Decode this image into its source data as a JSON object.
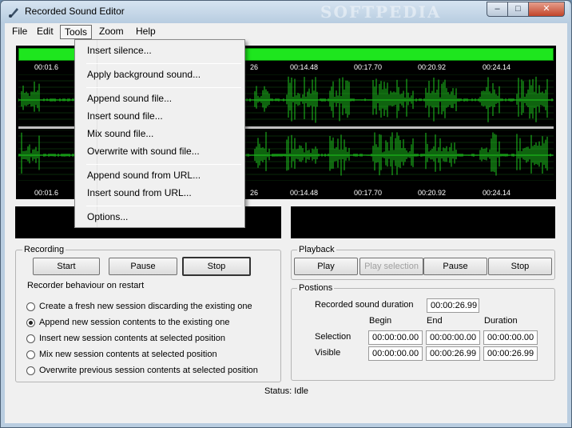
{
  "window": {
    "title": "Recorded Sound Editor",
    "watermark": "SOFTPEDIA",
    "minimize": "–",
    "maximize": "□",
    "close": "✕"
  },
  "menubar": {
    "items": [
      "File",
      "Edit",
      "Tools",
      "Zoom",
      "Help"
    ],
    "active": "Tools"
  },
  "tools_menu": {
    "items": [
      "Insert silence...",
      "Apply background sound...",
      "Append sound file...",
      "Insert sound file...",
      "Mix sound file...",
      "Overwrite with sound file...",
      "Append sound from URL...",
      "Insert sound from URL...",
      "Options..."
    ]
  },
  "ruler": {
    "top_ticks": [
      "00:01.6",
      "26",
      "00:14.48",
      "00:17.70",
      "00:20.92",
      "00:24.14"
    ],
    "bottom_ticks": [
      "00:01.6",
      "26",
      "00:14.48",
      "00:17.70",
      "00:20.92",
      "00:24.14"
    ]
  },
  "colors": {
    "waveform": "#1ec81e",
    "progress": "#1ee61e",
    "background": "#000000"
  },
  "recording": {
    "legend": "Recording",
    "start": "Start",
    "pause": "Pause",
    "stop": "Stop",
    "behaviour_label": "Recorder behaviour on restart",
    "options": [
      "Create a fresh new session discarding the existing one",
      "Append new session contents to the existing one",
      "Insert new session contents at selected position",
      "Mix new session contents at selected position",
      "Overwrite previous session contents at selected position"
    ],
    "selected_option": 1
  },
  "playback": {
    "legend": "Playback",
    "play": "Play",
    "play_selection": "Play selection",
    "pause": "Pause",
    "stop": "Stop"
  },
  "positions": {
    "legend": "Postions",
    "duration_label": "Recorded sound duration",
    "duration_value": "00:00:26.99",
    "col_begin": "Begin",
    "col_end": "End",
    "col_duration": "Duration",
    "selection_label": "Selection",
    "selection": {
      "begin": "00:00:00.00",
      "end": "00:00:00.00",
      "duration": "00:00:00.00"
    },
    "visible_label": "Visible",
    "visible": {
      "begin": "00:00:00.00",
      "end": "00:00:26.99",
      "duration": "00:00:26.99"
    }
  },
  "status": "Status: Idle"
}
